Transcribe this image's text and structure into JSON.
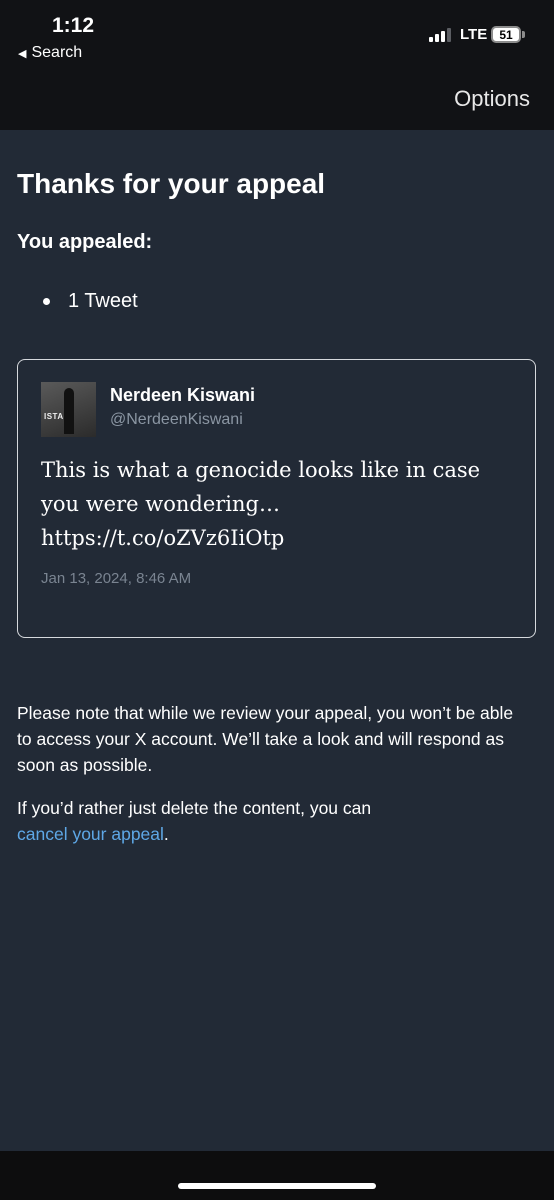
{
  "status_bar": {
    "time": "1:12",
    "back_label": "Search",
    "network": "LTE",
    "battery": "51"
  },
  "nav": {
    "options_label": "Options"
  },
  "page": {
    "title": "Thanks for your appeal",
    "appealed_heading": "You appealed:",
    "appealed_items": [
      "1 Tweet"
    ]
  },
  "tweet": {
    "author_name": "Nerdeen Kiswani",
    "handle": "@NerdeenKiswani",
    "text": "This is what a genocide looks like in case you were wondering… https://t.co/oZVz6IiOtp",
    "timestamp": "Jan 13, 2024, 8:46 AM",
    "avatar_sign_text": "ISTA"
  },
  "notice": {
    "paragraph": "Please note that while we review your appeal, you won’t be able to access your X account. We’ll take a look and will respond as soon as possible.",
    "cancel_prefix": "If you’d rather just delete the content, you can",
    "cancel_link": "cancel your appeal",
    "cancel_suffix": "."
  },
  "colors": {
    "background": "#222a36",
    "link": "#5ea7e6",
    "muted": "#8b96a3"
  }
}
